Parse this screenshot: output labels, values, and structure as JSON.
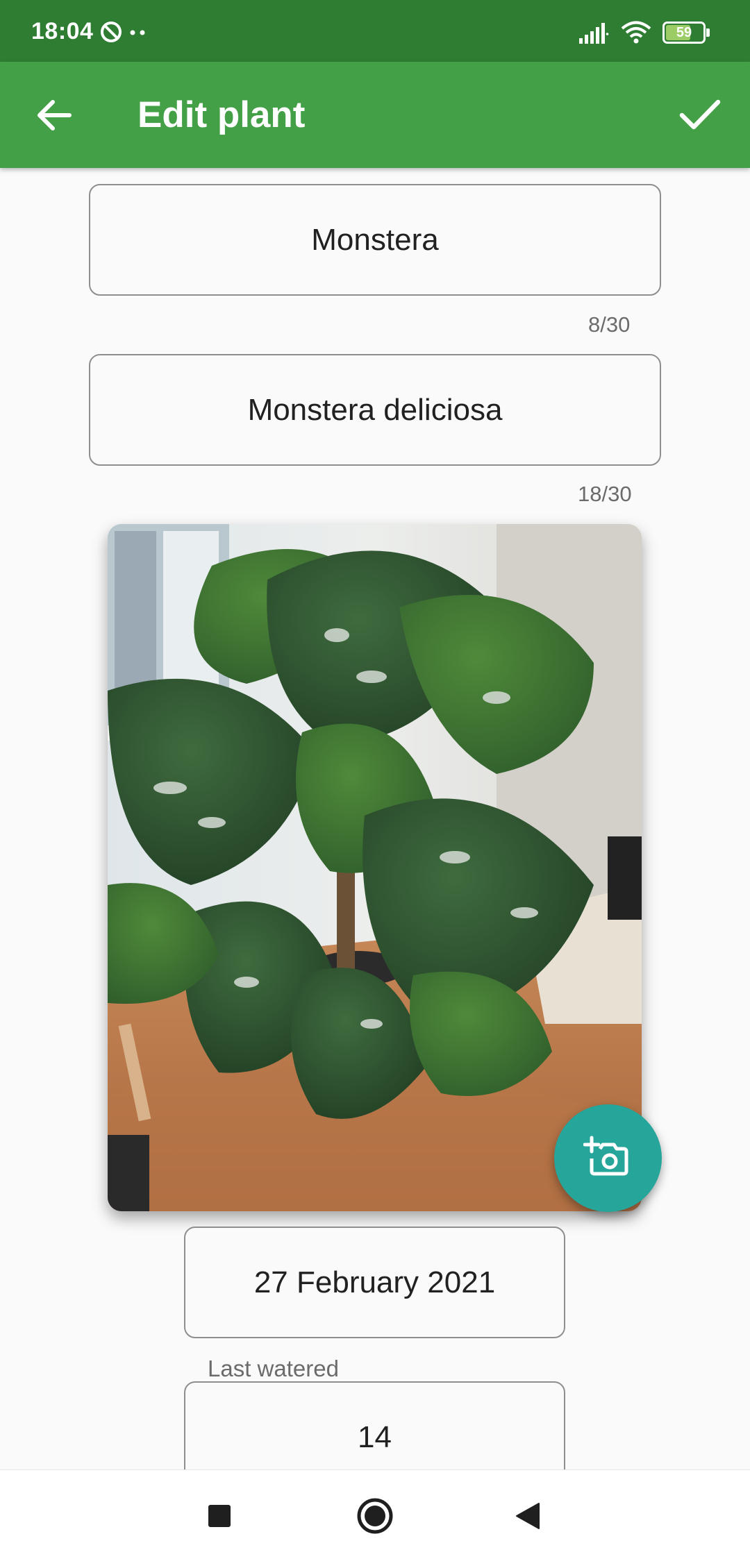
{
  "status_bar": {
    "time": "18:04",
    "battery": "59",
    "icons": [
      "data-saver-icon",
      "dots-icon",
      "signal-icon",
      "wifi-icon",
      "battery-icon"
    ]
  },
  "app_bar": {
    "title": "Edit plant",
    "back_icon": "arrow-back-icon",
    "confirm_icon": "check-icon"
  },
  "form": {
    "name": {
      "value": "Monstera",
      "counter": "8/30"
    },
    "species": {
      "value": "Monstera deliciosa",
      "counter": "18/30"
    },
    "photo": {
      "subject": "Monstera plant",
      "fab_icon": "add-camera-icon"
    },
    "date": {
      "value": "27 February 2021"
    },
    "last_watered": {
      "label": "Last watered",
      "value": "14"
    }
  },
  "nav_bar": {
    "icons": [
      "recents-square-icon",
      "home-circle-icon",
      "back-triangle-icon"
    ]
  },
  "colors": {
    "status_bar": "#2e7d32",
    "app_bar": "#43a047",
    "fab": "#26a69a",
    "background": "#fafafa"
  }
}
